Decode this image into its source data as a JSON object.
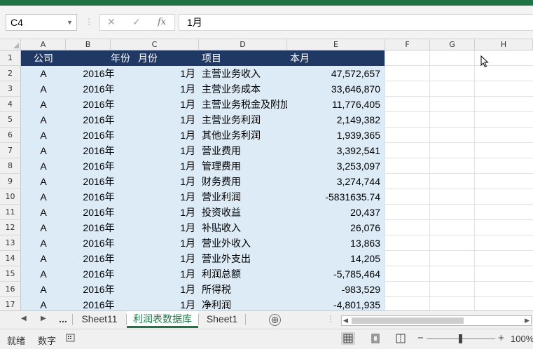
{
  "formula_bar": {
    "name_box": "C4",
    "cancel_icon": "✕",
    "enter_icon": "✓",
    "fx_label": "fx",
    "formula_value": "1月"
  },
  "columns": [
    "A",
    "B",
    "C",
    "D",
    "E",
    "F",
    "G",
    "H"
  ],
  "header_row": {
    "row_number": "1",
    "cells": [
      "公司",
      "年份",
      "月份",
      "项目",
      "本月"
    ]
  },
  "rows": [
    {
      "num": "2",
      "company": "A",
      "year": "2016年",
      "month": "1月",
      "item": "主营业务收入",
      "value": "47,572,657"
    },
    {
      "num": "3",
      "company": "A",
      "year": "2016年",
      "month": "1月",
      "item": "主营业务成本",
      "value": "33,646,870"
    },
    {
      "num": "4",
      "company": "A",
      "year": "2016年",
      "month": "1月",
      "item": "主营业务税金及附加",
      "value": "11,776,405"
    },
    {
      "num": "5",
      "company": "A",
      "year": "2016年",
      "month": "1月",
      "item": "主营业务利润",
      "value": "2,149,382"
    },
    {
      "num": "6",
      "company": "A",
      "year": "2016年",
      "month": "1月",
      "item": "其他业务利润",
      "value": "1,939,365"
    },
    {
      "num": "7",
      "company": "A",
      "year": "2016年",
      "month": "1月",
      "item": "营业费用",
      "value": "3,392,541"
    },
    {
      "num": "8",
      "company": "A",
      "year": "2016年",
      "month": "1月",
      "item": "管理费用",
      "value": "3,253,097"
    },
    {
      "num": "9",
      "company": "A",
      "year": "2016年",
      "month": "1月",
      "item": "财务费用",
      "value": "3,274,744"
    },
    {
      "num": "10",
      "company": "A",
      "year": "2016年",
      "month": "1月",
      "item": "营业利润",
      "value": "-5831635.74"
    },
    {
      "num": "11",
      "company": "A",
      "year": "2016年",
      "month": "1月",
      "item": "投资收益",
      "value": "20,437"
    },
    {
      "num": "12",
      "company": "A",
      "year": "2016年",
      "month": "1月",
      "item": "补贴收入",
      "value": "26,076"
    },
    {
      "num": "13",
      "company": "A",
      "year": "2016年",
      "month": "1月",
      "item": "营业外收入",
      "value": "13,863"
    },
    {
      "num": "14",
      "company": "A",
      "year": "2016年",
      "month": "1月",
      "item": "营业外支出",
      "value": "14,205"
    },
    {
      "num": "15",
      "company": "A",
      "year": "2016年",
      "month": "1月",
      "item": "利润总额",
      "value": "-5,785,464"
    },
    {
      "num": "16",
      "company": "A",
      "year": "2016年",
      "month": "1月",
      "item": "所得税",
      "value": "-983,529"
    },
    {
      "num": "17",
      "company": "A",
      "year": "2016年",
      "month": "1月",
      "item": "净利润",
      "value": "-4,801,935"
    }
  ],
  "sheet_tabs": {
    "more": "...",
    "tabs": [
      "Sheet11",
      "利润表数据库",
      "Sheet1"
    ],
    "active_index": 1,
    "add_icon": "⊕"
  },
  "status_bar": {
    "ready": "就绪",
    "num_lock": "数字",
    "zoom_minus": "−",
    "zoom_plus": "+",
    "zoom_level": "100%"
  },
  "colors": {
    "accent": "#217346",
    "header_fill": "#1f3864",
    "data_fill": "#ddebf7"
  }
}
